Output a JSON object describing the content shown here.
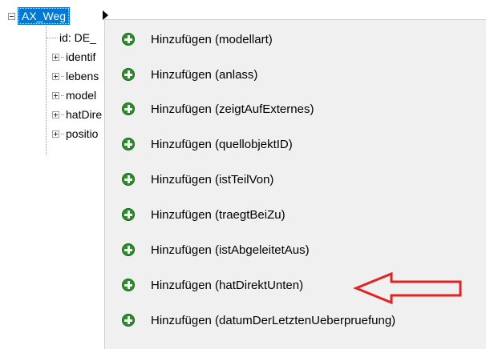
{
  "tree": {
    "root": {
      "label": "AX_Weg",
      "expanded": true
    },
    "children": [
      {
        "label": "id: DE_",
        "expandable": false
      },
      {
        "label": "identif",
        "expandable": true
      },
      {
        "label": "lebens",
        "expandable": true
      },
      {
        "label": "model",
        "expandable": true
      },
      {
        "label": "hatDire",
        "expandable": true
      },
      {
        "label": "positio",
        "expandable": true
      }
    ]
  },
  "context_menu": {
    "items": [
      {
        "label": "Hinzufügen (modellart)",
        "icon": "add-plus-icon"
      },
      {
        "label": "Hinzufügen (anlass)",
        "icon": "add-plus-icon"
      },
      {
        "label": "Hinzufügen (zeigtAufExternes)",
        "icon": "add-plus-icon"
      },
      {
        "label": "Hinzufügen (quellobjektID)",
        "icon": "add-plus-icon"
      },
      {
        "label": "Hinzufügen (istTeilVon)",
        "icon": "add-plus-icon"
      },
      {
        "label": "Hinzufügen (traegtBeiZu)",
        "icon": "add-plus-icon"
      },
      {
        "label": "Hinzufügen (istAbgeleitetAus)",
        "icon": "add-plus-icon"
      },
      {
        "label": "Hinzufügen (hatDirektUnten)",
        "icon": "add-plus-icon",
        "annotated": true
      },
      {
        "label": "Hinzufügen (datumDerLetztenUeberpruefung)",
        "icon": "add-plus-icon"
      }
    ]
  },
  "colors": {
    "selection": "#0078d7",
    "menu_background": "#f0f0f0",
    "plus_icon": "#2e8b2e",
    "annotation_arrow": "#e32222"
  }
}
